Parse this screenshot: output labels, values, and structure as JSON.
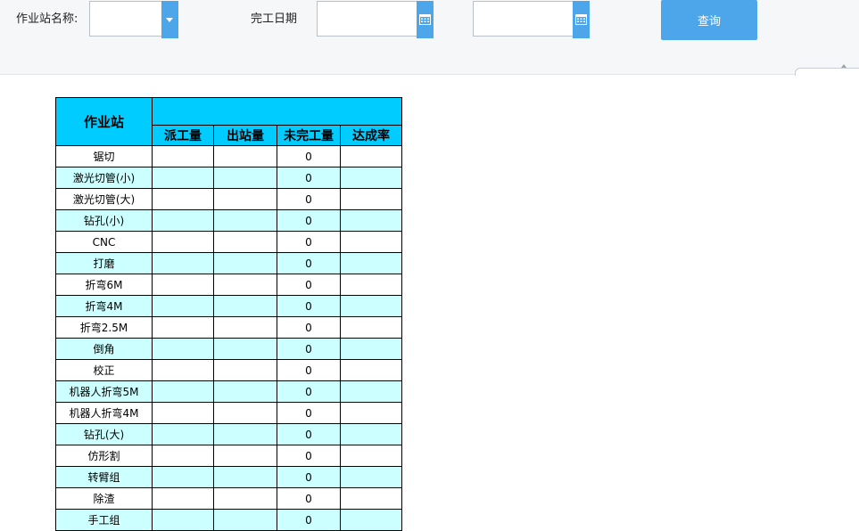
{
  "filters": {
    "station_label": "作业站名称:",
    "station_value": "",
    "date_label": "完工日期",
    "date_from": "",
    "date_to": "",
    "query_button": "查询"
  },
  "table": {
    "header_station": "作业站",
    "header_group": "",
    "columns": [
      "派工量",
      "出站量",
      "未完工量",
      "达成率"
    ],
    "rows": [
      {
        "station": "锯切",
        "dispatched": "",
        "out": "",
        "unfinished": "0",
        "rate": ""
      },
      {
        "station": "激光切管(小)",
        "dispatched": "",
        "out": "",
        "unfinished": "0",
        "rate": ""
      },
      {
        "station": "激光切管(大)",
        "dispatched": "",
        "out": "",
        "unfinished": "0",
        "rate": ""
      },
      {
        "station": "钻孔(小)",
        "dispatched": "",
        "out": "",
        "unfinished": "0",
        "rate": ""
      },
      {
        "station": "CNC",
        "dispatched": "",
        "out": "",
        "unfinished": "0",
        "rate": ""
      },
      {
        "station": "打磨",
        "dispatched": "",
        "out": "",
        "unfinished": "0",
        "rate": ""
      },
      {
        "station": "折弯6M",
        "dispatched": "",
        "out": "",
        "unfinished": "0",
        "rate": ""
      },
      {
        "station": "折弯4M",
        "dispatched": "",
        "out": "",
        "unfinished": "0",
        "rate": ""
      },
      {
        "station": "折弯2.5M",
        "dispatched": "",
        "out": "",
        "unfinished": "0",
        "rate": ""
      },
      {
        "station": "倒角",
        "dispatched": "",
        "out": "",
        "unfinished": "0",
        "rate": ""
      },
      {
        "station": "校正",
        "dispatched": "",
        "out": "",
        "unfinished": "0",
        "rate": ""
      },
      {
        "station": "机器人折弯5M",
        "dispatched": "",
        "out": "",
        "unfinished": "0",
        "rate": ""
      },
      {
        "station": "机器人折弯4M",
        "dispatched": "",
        "out": "",
        "unfinished": "0",
        "rate": ""
      },
      {
        "station": "钻孔(大)",
        "dispatched": "",
        "out": "",
        "unfinished": "0",
        "rate": ""
      },
      {
        "station": "仿形割",
        "dispatched": "",
        "out": "",
        "unfinished": "0",
        "rate": ""
      },
      {
        "station": "转臂组",
        "dispatched": "",
        "out": "",
        "unfinished": "0",
        "rate": ""
      },
      {
        "station": "除渣",
        "dispatched": "",
        "out": "",
        "unfinished": "0",
        "rate": ""
      },
      {
        "station": "手工组",
        "dispatched": "",
        "out": "",
        "unfinished": "0",
        "rate": ""
      }
    ]
  },
  "colors": {
    "accent": "#4ea6ea",
    "header_fill": "#00ccff",
    "stripe_fill": "#ccffff"
  },
  "icons": {
    "station_dropdown": "chevron-down-icon",
    "date_picker": "calendar-icon"
  }
}
